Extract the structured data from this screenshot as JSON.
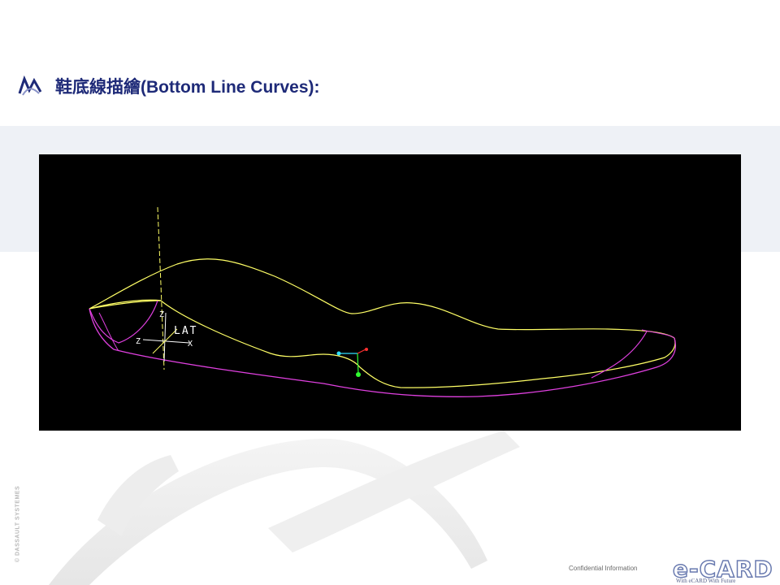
{
  "slide": {
    "title": "鞋底線描繪(Bottom Line Curves):",
    "copyright": "© DASSAULT SYSTEMES",
    "footer_confidential": "Confidential Information",
    "logo_text": "e-CARD",
    "logo_tagline": "With eCARD With Future"
  },
  "viewport": {
    "axis_z_top": "Z",
    "axis_z_left": "Z",
    "axis_x": "X",
    "lat_label": "LAT",
    "background": "#000000",
    "colors": {
      "top_curve": "#ffff66",
      "bottom_curve": "#e040e0",
      "accent_red": "#ff3030",
      "accent_green": "#30ff30",
      "accent_cyan": "#30e0ff"
    }
  },
  "icons": {
    "title_bullet": "catia-logo-icon"
  }
}
